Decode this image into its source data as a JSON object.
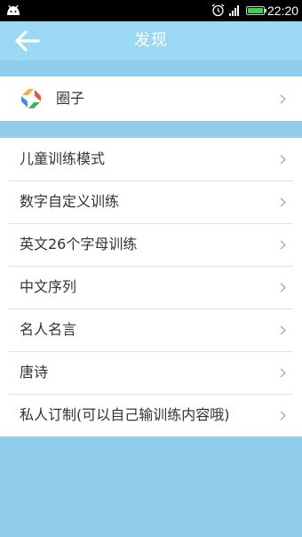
{
  "status_bar": {
    "time": "22:20",
    "icons": [
      "android-icon",
      "alarm-icon",
      "signal-icon",
      "battery-icon"
    ],
    "battery_color": "#3fd24a"
  },
  "header": {
    "title": "发现",
    "back_icon": "back-arrow-icon",
    "background": "#9bd8f3"
  },
  "circle_section": {
    "label": "圈子",
    "icon": "circle-logo-icon"
  },
  "training_list": [
    {
      "label": "儿童训练模式"
    },
    {
      "label": "数字自定义训练"
    },
    {
      "label": "英文26个字母训练"
    },
    {
      "label": "中文序列"
    },
    {
      "label": "名人名言"
    },
    {
      "label": "唐诗"
    },
    {
      "label": "私人订制(可以自己输训练内容哦)"
    }
  ],
  "colors": {
    "page_background": "#8fcdea",
    "header": "#9bd8f3",
    "list_background": "#ffffff"
  }
}
